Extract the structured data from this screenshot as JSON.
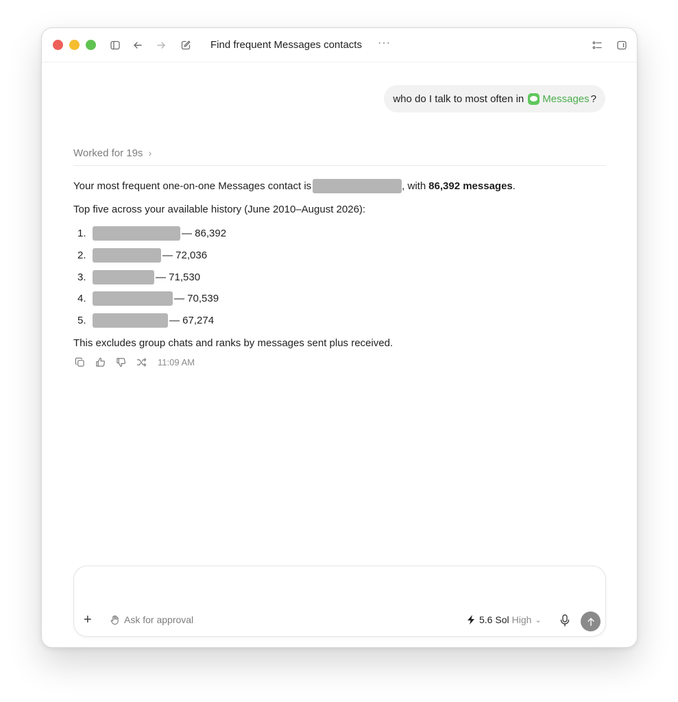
{
  "window": {
    "title": "Find frequent Messages contacts",
    "more_label": "···"
  },
  "user_message": {
    "prefix": "who do I talk to most often in",
    "app_name": "Messages",
    "suffix": "?"
  },
  "worked": {
    "label": "Worked for 19s",
    "chevron": "›"
  },
  "answer": {
    "intro_prefix": "Your most frequent one-on-one Messages contact is",
    "intro_mid": ", with",
    "intro_bold": "86,392 messages",
    "intro_end": ".",
    "top_heading": "Top five across your available history (June 2010–August 2026):",
    "items": [
      {
        "num": "1.",
        "count": "— 86,392"
      },
      {
        "num": "2.",
        "count": "— 72,036"
      },
      {
        "num": "3.",
        "count": "— 71,530"
      },
      {
        "num": "4.",
        "count": "— 70,539"
      },
      {
        "num": "5.",
        "count": "— 67,274"
      }
    ],
    "footnote": "This excludes group chats and ranks by messages sent plus received.",
    "timestamp": "11:09 AM"
  },
  "composer": {
    "plus": "+",
    "approval_label": "Ask for approval",
    "model_name": "5.6 Sol",
    "effort": "High",
    "dropdown": "⌄"
  },
  "colors": {
    "accent_green": "#4cae4e",
    "traffic_red": "#ee5f58",
    "traffic_yellow": "#f5bd30",
    "traffic_green": "#5fc351",
    "send_button": "#8a8a8a"
  }
}
